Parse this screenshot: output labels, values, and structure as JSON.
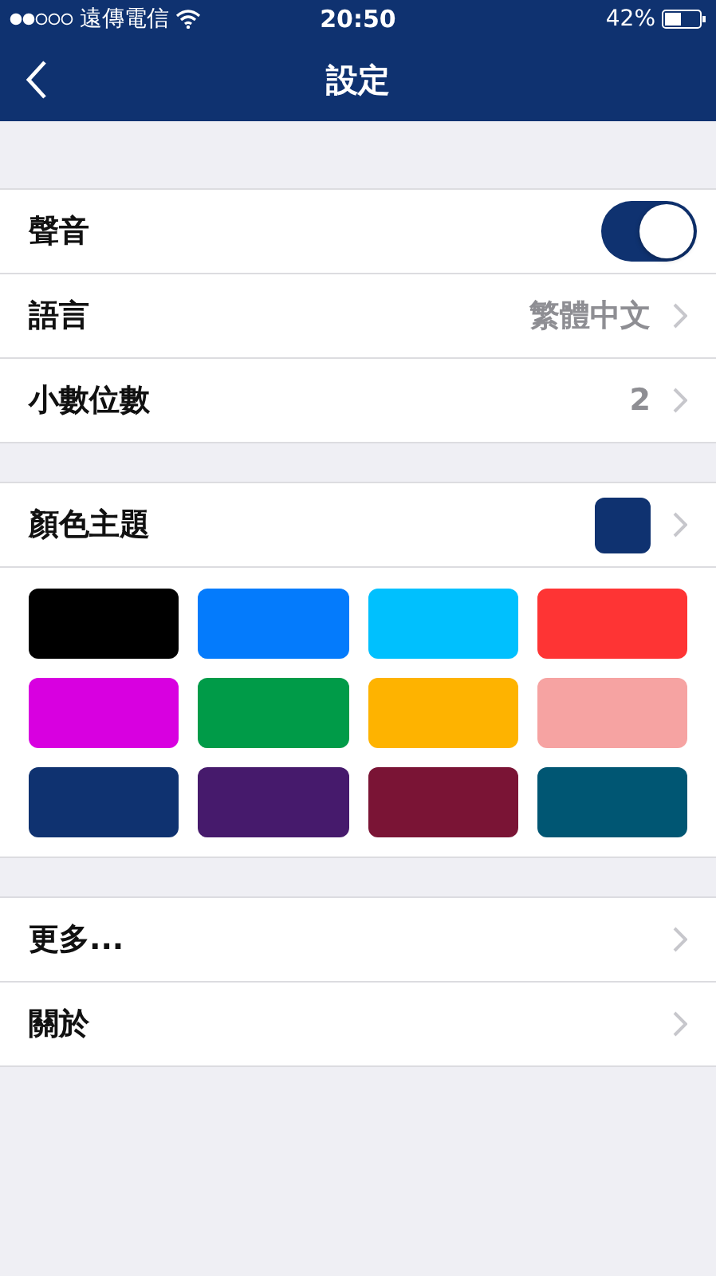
{
  "status_bar": {
    "carrier": "遠傳電信",
    "time": "20:50",
    "battery": "42%"
  },
  "nav": {
    "title": "設定"
  },
  "groups": [
    {
      "rows": [
        {
          "kind": "toggle",
          "label": "聲音",
          "on": true
        },
        {
          "kind": "value",
          "label": "語言",
          "value": "繁體中文"
        },
        {
          "kind": "value",
          "label": "小數位數",
          "value": "2"
        }
      ]
    },
    {
      "rows": [
        {
          "kind": "color",
          "label": "顏色主題",
          "color": "#0f3270"
        }
      ],
      "swatches": [
        {
          "color": "#000000"
        },
        {
          "color": "#047bfc"
        },
        {
          "color": "#00c0fe"
        },
        {
          "color": "#fe3434"
        },
        {
          "color": "#d800e0"
        },
        {
          "color": "#009b48"
        },
        {
          "color": "#feb300"
        },
        {
          "color": "#f6a3a2"
        },
        {
          "color": "#0f3270"
        },
        {
          "color": "#461a6c"
        },
        {
          "color": "#7a1435"
        },
        {
          "color": "#005673"
        }
      ]
    },
    {
      "rows": [
        {
          "kind": "link",
          "label": "更多..."
        },
        {
          "kind": "link",
          "label": "關於"
        }
      ]
    }
  ]
}
